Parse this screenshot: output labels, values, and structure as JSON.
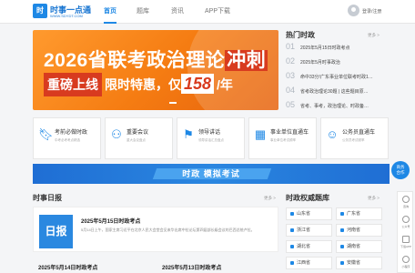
{
  "nav": {
    "logo_badge": "时",
    "logo_name": "时事一点通",
    "logo_url": "WWW.SDYDT.COM",
    "items": [
      "首页",
      "题库",
      "资讯",
      "APP下载"
    ],
    "login": "登录/注册"
  },
  "banner": {
    "line1_text": "2026省联考政治理论",
    "line1_highlight": "冲刺",
    "tag": "重磅上线",
    "sub": "限时特惠，仅",
    "price": "158",
    "unit": "/年"
  },
  "hot": {
    "title": "热门时政",
    "more": "更多 >",
    "items": [
      {
        "num": "01",
        "text": "2025年5月15日时政考点"
      },
      {
        "num": "02",
        "text": "2025年5月时事政治"
      },
      {
        "num": "03",
        "text": "命中33分!广东事业单位联考时政1…"
      },
      {
        "num": "04",
        "text": "省考政治理论30题 | 这些题目原…"
      },
      {
        "num": "05",
        "text": "省考、事考，政治理论、时政备…"
      }
    ]
  },
  "cards": [
    {
      "icon": "bookmark-icon",
      "title": "考前必做时政",
      "sub": "中考必考考点精选"
    },
    {
      "icon": "people-icon",
      "title": "重要会议",
      "sub": "重大会议盘点"
    },
    {
      "icon": "flag-icon",
      "title": "领导讲话",
      "sub": "领导讲话汇总盘点"
    },
    {
      "icon": "building-icon",
      "title": "事业单位直通车",
      "sub": "事业单位考试频率"
    },
    {
      "icon": "user-icon",
      "title": "公务员直通车",
      "sub": "公务员考试频率"
    }
  ],
  "strip": {
    "text": "时政 模拟考试"
  },
  "daily": {
    "title": "时事日报",
    "more": "更多 >",
    "icon_text": "日报",
    "feature_title": "2025年5月15日时政考点",
    "feature_desc": "5月14日上午，国家主席习近平在北京人民大会堂会见来华出席中拉论坛第四届部长级会议的巴西总统卢拉。",
    "news": [
      "2025年5月14日时政考点",
      "2025年5月13日时政考点"
    ]
  },
  "authority": {
    "title": "时政权威题库",
    "more": "更多 >",
    "provinces": [
      "山东省",
      "广东省",
      "浙江省",
      "河南省",
      "湖北省",
      "湖南省",
      "江西省",
      "安徽省"
    ]
  },
  "side": {
    "fab": [
      "商务",
      "合作"
    ],
    "tools": [
      {
        "icon": "chat-icon",
        "label": "咨询"
      },
      {
        "icon": "wechat-icon",
        "label": "公众号"
      },
      {
        "icon": "app-icon",
        "label": "下载APP"
      },
      {
        "icon": "mini-program-icon",
        "label": "小程序"
      }
    ]
  },
  "colors": {
    "brand": "#1e88e5",
    "banner_orange": "#f57c12",
    "banner_red": "#d83b1f"
  }
}
